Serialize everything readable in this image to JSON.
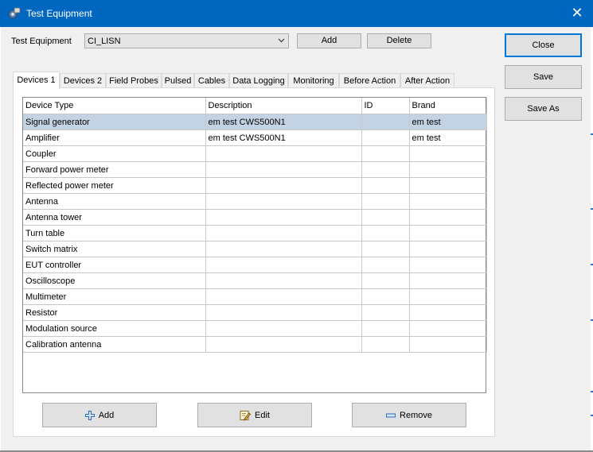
{
  "window": {
    "title": "Test Equipment",
    "close_glyph": "✕"
  },
  "header": {
    "label": "Test Equipment",
    "combo_value": "CI_LISN",
    "add_label": "Add",
    "delete_label": "Delete"
  },
  "side_buttons": {
    "close": "Close",
    "save": "Save",
    "save_as": "Save As"
  },
  "tabs": [
    {
      "label": "Devices 1",
      "active": true
    },
    {
      "label": "Devices 2"
    },
    {
      "label": "Field Probes"
    },
    {
      "label": "Pulsed"
    },
    {
      "label": "Cables"
    },
    {
      "label": "Data Logging"
    },
    {
      "label": "Monitoring"
    },
    {
      "label": "Before Action"
    },
    {
      "label": "After Action"
    }
  ],
  "table": {
    "columns": [
      "Device Type",
      "Description",
      "ID",
      "Brand"
    ],
    "rows": [
      [
        "Signal generator",
        "em test CWS500N1",
        "",
        "em test"
      ],
      [
        "Amplifier",
        "em test CWS500N1",
        "",
        "em test"
      ],
      [
        "Coupler",
        "",
        "",
        ""
      ],
      [
        "Forward power meter",
        "",
        "",
        ""
      ],
      [
        "Reflected power meter",
        "",
        "",
        ""
      ],
      [
        "Antenna",
        "",
        "",
        ""
      ],
      [
        "Antenna tower",
        "",
        "",
        ""
      ],
      [
        "Turn table",
        "",
        "",
        ""
      ],
      [
        "Switch matrix",
        "",
        "",
        ""
      ],
      [
        "EUT controller",
        "",
        "",
        ""
      ],
      [
        "Oscilloscope",
        "",
        "",
        ""
      ],
      [
        "Multimeter",
        "",
        "",
        ""
      ],
      [
        "Resistor",
        "",
        "",
        ""
      ],
      [
        "Modulation source",
        "",
        "",
        ""
      ],
      [
        "Calibration antenna",
        "",
        "",
        ""
      ]
    ],
    "selected_row": 0
  },
  "bottom_buttons": {
    "add": "Add",
    "edit": "Edit",
    "remove": "Remove"
  },
  "colors": {
    "titlebar": "#0067c0",
    "selection": "#c4d3e4",
    "default_button_border": "#0078d7"
  },
  "icons": {
    "app": "equipment-icon",
    "add": "plus-icon",
    "edit": "edit-icon",
    "remove": "minus-icon"
  }
}
